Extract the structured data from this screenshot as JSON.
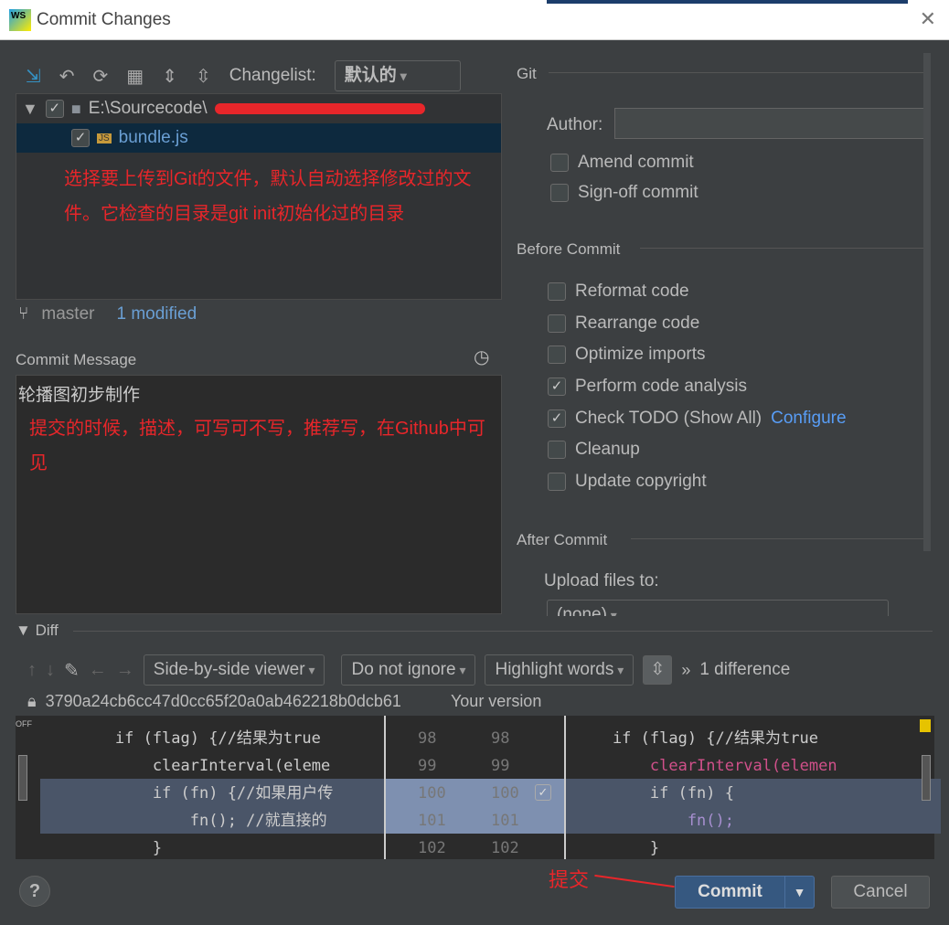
{
  "window": {
    "title": "Commit Changes",
    "app_icon": "WS"
  },
  "toolbar": {
    "changelist_label": "Changelist:",
    "changelist_value": "默认的"
  },
  "tree": {
    "root": "E:\\Sourcecode\\",
    "file": "bundle.js",
    "file_badge": "JS"
  },
  "annotations": {
    "files": "选择要上传到Git的文件，默认自动选择修改过的文件。它检查的目录是git init初始化过的目录",
    "message": "提交的时候，描述，可写可不写，推荐写，在Github中可见",
    "commit": "提交"
  },
  "status": {
    "branch": "master",
    "modified": "1 modified"
  },
  "commit_message": {
    "label": "Commit Message",
    "value": "轮播图初步制作"
  },
  "git": {
    "section": "Git",
    "author_label": "Author:",
    "author_value": "",
    "amend": "Amend commit",
    "signoff": "Sign-off commit"
  },
  "before_commit": {
    "section": "Before Commit",
    "options": [
      {
        "label": "Reformat code",
        "checked": false
      },
      {
        "label": "Rearrange code",
        "checked": false
      },
      {
        "label": "Optimize imports",
        "checked": false
      },
      {
        "label": "Perform code analysis",
        "checked": true
      },
      {
        "label": "Check TODO (Show All)",
        "checked": true
      },
      {
        "label": "Cleanup",
        "checked": false
      },
      {
        "label": "Update copyright",
        "checked": false
      }
    ],
    "configure": "Configure"
  },
  "after_commit": {
    "section": "After Commit",
    "upload_label": "Upload files to:",
    "upload_value": "(none)"
  },
  "diff": {
    "label": "Diff",
    "viewer": "Side-by-side viewer",
    "ignore": "Do not ignore",
    "highlight": "Highlight words",
    "count": "1 difference",
    "hash": "3790a24cb6cc47d0cc65f20a0ab462218b0dcb61",
    "right_title": "Your version",
    "off": "OFF",
    "left_lines": [
      "        if (flag) {//结果为true",
      "            clearInterval(eleme",
      "            if (fn) {//如果用户传",
      "                fn(); //就直接的",
      "            }"
    ],
    "right_lines": [
      "    if (flag) {//结果为true",
      "        clearInterval(elemen",
      "        if (fn) {",
      "            fn();",
      "        }"
    ],
    "line_numbers": [
      "98",
      "99",
      "100",
      "101",
      "102"
    ]
  },
  "buttons": {
    "help": "?",
    "commit": "Commit",
    "cancel": "Cancel"
  }
}
